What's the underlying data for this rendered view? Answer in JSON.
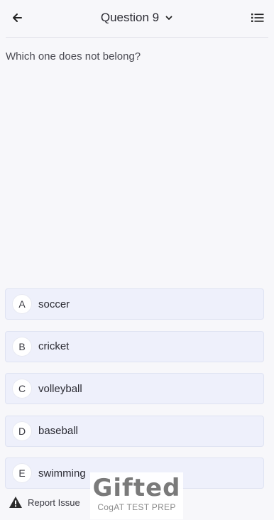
{
  "header": {
    "back_icon": "arrow-left-icon",
    "title": "Question 9",
    "dropdown_icon": "chevron-down-icon",
    "list_icon": "list-icon"
  },
  "question": {
    "text": "Which one does not belong?"
  },
  "options": [
    {
      "letter": "A",
      "text": "soccer"
    },
    {
      "letter": "B",
      "text": "cricket"
    },
    {
      "letter": "C",
      "text": "volleyball"
    },
    {
      "letter": "D",
      "text": "baseball"
    },
    {
      "letter": "E",
      "text": "swimming"
    }
  ],
  "footer": {
    "report_icon": "warning-icon",
    "report_label": "Report Issue"
  },
  "watermark": {
    "logo": "Gifted",
    "subtitle": "CogAT TEST PREP"
  }
}
